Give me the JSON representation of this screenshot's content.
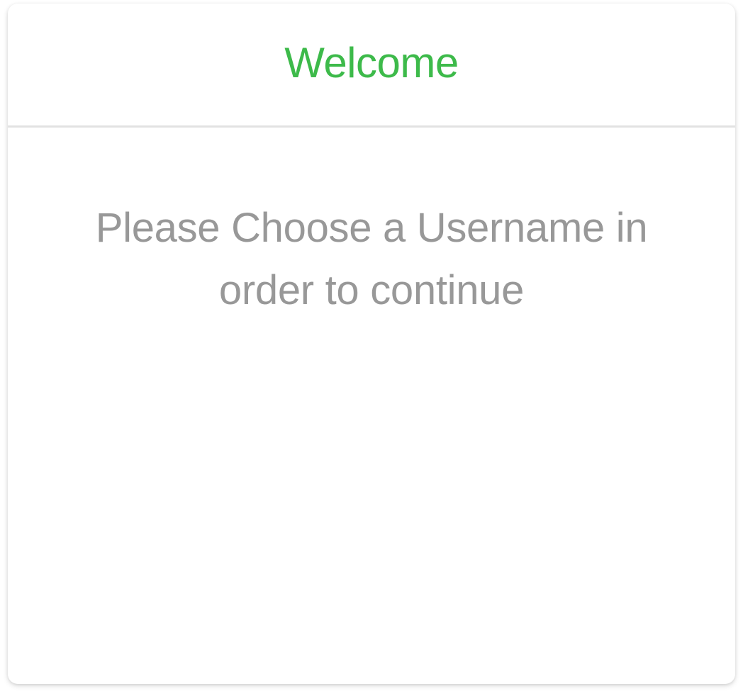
{
  "dialog": {
    "title": "Welcome",
    "message": "Please Choose a Username in order to continue"
  },
  "colors": {
    "accent": "#3dba4a",
    "message_text": "#989898",
    "divider": "#e2e2e2",
    "background": "#ffffff"
  }
}
